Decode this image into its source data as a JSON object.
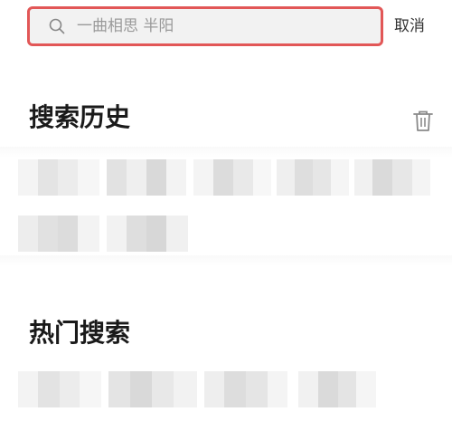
{
  "search": {
    "placeholder": "一曲相思 半阳",
    "cancel_label": "取消"
  },
  "history": {
    "title": "搜索历史",
    "delete_icon": "trash-icon"
  },
  "hot": {
    "title": "热门搜索"
  },
  "colors": {
    "accent_border": "#e25757",
    "search_bg": "#f2f2f2"
  }
}
